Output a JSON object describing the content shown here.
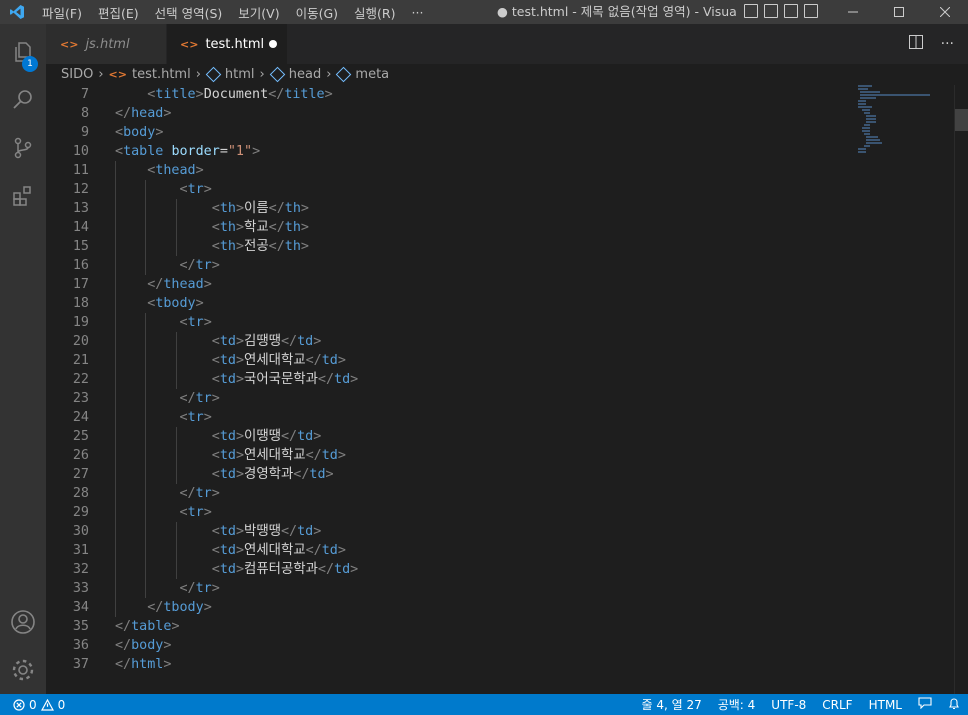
{
  "menu": [
    "파일(F)",
    "편집(E)",
    "선택 영역(S)",
    "보기(V)",
    "이동(G)",
    "실행(R)",
    "···"
  ],
  "window_title": "● test.html - 제목 없음(작업 영역) - Visual S...",
  "tabs": [
    {
      "label": "js.html",
      "active": false
    },
    {
      "label": "test.html",
      "active": true,
      "modified": true
    }
  ],
  "breadcrumb": [
    "SIDO",
    "test.html",
    "html",
    "head",
    "meta"
  ],
  "activity_badge": "1",
  "code": {
    "line_numbers": [
      "7",
      "8",
      "9",
      "10",
      "11",
      "12",
      "13",
      "14",
      "15",
      "16",
      "17",
      "18",
      "19",
      "20",
      "21",
      "22",
      "23",
      "24",
      "25",
      "26",
      "27",
      "28",
      "29",
      "30",
      "31",
      "32",
      "33",
      "34",
      "35",
      "36",
      "37"
    ]
  },
  "status": {
    "errors": "0",
    "warnings": "0",
    "position": "줄 4, 열 27",
    "spaces": "공백: 4",
    "encoding": "UTF-8",
    "eol": "CRLF",
    "language": "HTML"
  },
  "colors": {
    "tag_bracket": "#808080",
    "tag_name": "#569cd6",
    "attr_name": "#9cdcfe",
    "attr_value": "#ce9178",
    "text": "#d4d4d4",
    "status_bar": "#007acc",
    "html_icon": "#e37933"
  }
}
